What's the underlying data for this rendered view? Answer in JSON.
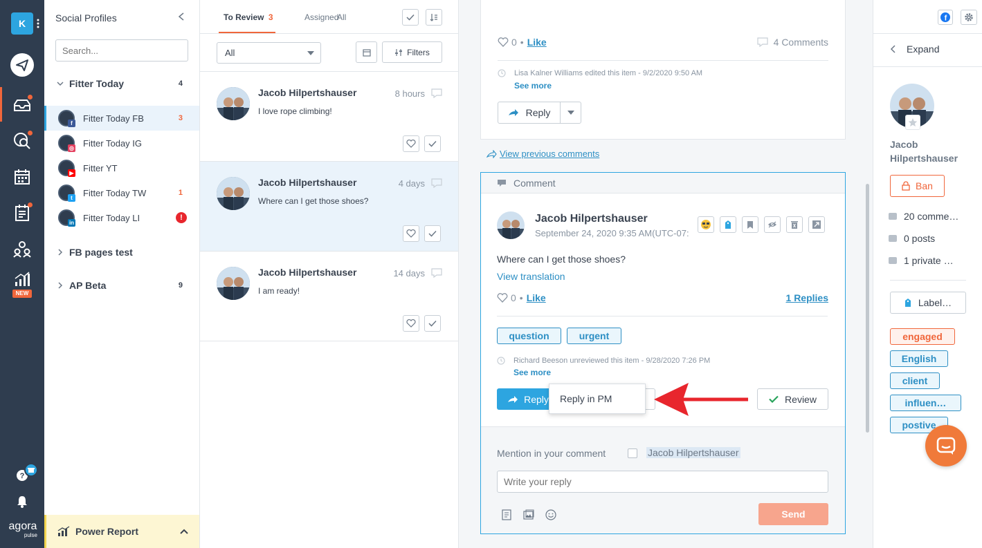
{
  "rail": {
    "account_initial": "K",
    "logo_text": "agora",
    "logo_sub": "pulse",
    "new_badge": "NEW",
    "icons": [
      "publish-icon",
      "inbox-icon",
      "listening-icon",
      "calendar-icon",
      "reports-icon",
      "team-icon",
      "analytics-icon",
      "help-icon",
      "bell-icon"
    ]
  },
  "profiles": {
    "title": "Social Profiles",
    "search_placeholder": "Search...",
    "groups": [
      {
        "name": "Fitter Today",
        "count": "4"
      },
      {
        "name": "FB pages test",
        "count": ""
      },
      {
        "name": "AP Beta",
        "count": "9"
      }
    ],
    "items": [
      {
        "label": "Fitter Today FB",
        "count": "3",
        "network": "facebook",
        "color": "#3b5998"
      },
      {
        "label": "Fitter Today IG",
        "count": "",
        "network": "instagram",
        "color": "#e4405f"
      },
      {
        "label": "Fitter YT",
        "count": "",
        "network": "youtube",
        "color": "#ff0000"
      },
      {
        "label": "Fitter Today TW",
        "count": "1",
        "network": "twitter",
        "color": "#1da1f2"
      },
      {
        "label": "Fitter Today LI",
        "count": "!",
        "network": "linkedin",
        "color": "#0077b5"
      }
    ],
    "power_report": "Power Report"
  },
  "inbox": {
    "tabs": [
      {
        "label": "To Review",
        "count": "3"
      },
      {
        "label": "Assigned"
      },
      {
        "label": "All"
      }
    ],
    "filter_value": "All",
    "filters_label": "Filters",
    "messages": [
      {
        "name": "Jacob Hilpertshauser",
        "text": "I love rope climbing!",
        "time": "8 hours"
      },
      {
        "name": "Jacob Hilpertshauser",
        "text": "Where can I get those shoes?",
        "time": "4 days"
      },
      {
        "name": "Jacob Hilpertshauser",
        "text": "I am ready!",
        "time": "14 days"
      }
    ]
  },
  "main": {
    "top_card": {
      "likes": "0",
      "like_label": "Like",
      "comments": "4 Comments",
      "audit": "Lisa Kalner Williams edited this item - 9/2/2020 9:50 AM",
      "see_more": "See more",
      "reply_label": "Reply"
    },
    "view_previous": "View previous comments",
    "comment_header": "Comment",
    "comment": {
      "author": "Jacob Hilpertshauser",
      "date": "September 24, 2020 9:35 AM(UTC-07:",
      "text": "Where can I get those shoes?",
      "view_translation": "View translation",
      "likes": "0",
      "like_label": "Like",
      "replies": "1 Replies",
      "tags": [
        "question",
        "urgent"
      ],
      "audit": "Richard Beeson unreviewed this item - 9/28/2020 7:26 PM",
      "see_more": "See more",
      "reply_label": "Reply",
      "dropdown_item": "Reply in PM",
      "review_label": "Review"
    },
    "composer": {
      "mention_label": "Mention in your comment",
      "mention_name": "Jacob Hilpertshauser",
      "placeholder": "Write your reply",
      "send_label": "Send"
    }
  },
  "right": {
    "expand_label": "Expand",
    "user_name_line1": "Jacob",
    "user_name_line2": "Hilpertshauser",
    "ban_label": "Ban",
    "stats": [
      "20 comme…",
      "0 posts",
      "1 private …"
    ],
    "label_button": "Label…",
    "labels": [
      {
        "text": "engaged",
        "style": "orange"
      },
      {
        "text": "English",
        "style": "blue"
      },
      {
        "text": "client",
        "style": "blue"
      },
      {
        "text": "influen…",
        "style": "blue"
      },
      {
        "text": "postive",
        "style": "blue"
      }
    ]
  },
  "colors": {
    "rail": "#2f3d4f",
    "accent_blue": "#2da5e0",
    "accent_orange": "#f0663b",
    "link": "#2d8fc4",
    "send_button": "#f7a58d"
  }
}
